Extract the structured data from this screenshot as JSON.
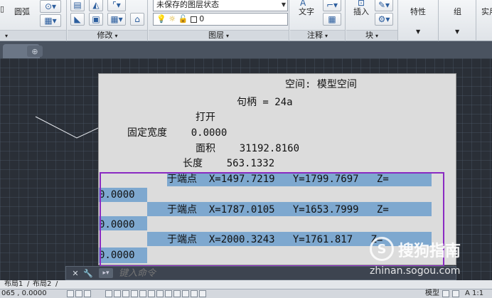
{
  "ribbon": {
    "draw_panel": {
      "arc_label": "圆弧",
      "title": ""
    },
    "modify_panel": {
      "title": "修改"
    },
    "layers_panel": {
      "layer_state": "未保存的图层状态",
      "current_layer": "0",
      "title": "图层"
    },
    "annotation_panel": {
      "text_label": "文字",
      "title": "注释"
    },
    "block_panel": {
      "insert_label": "插入",
      "title": "块"
    },
    "properties_label": "特性",
    "group_label": "组",
    "utilities_label": "实用"
  },
  "tabs": {
    "close_glyph": "×"
  },
  "text_window": {
    "lines": [
      "空间: 模型空间",
      "句柄 = 24a",
      "打开",
      "固定宽度    0.0000",
      "面积    31192.8160",
      "长度    563.1332"
    ],
    "points": [
      {
        "label": "于端点",
        "x": "X=1497.7219",
        "y": "Y=1799.7697",
        "z": "Z=",
        "zval": "0.0000"
      },
      {
        "label": "于端点",
        "x": "X=1787.0105",
        "y": "Y=1653.7999",
        "z": "Z=",
        "zval": "0.0000"
      },
      {
        "label": "于端点",
        "x": "X=2000.3243",
        "y": "Y=1761.817",
        "z": "Z=",
        "zval": "0.0000"
      }
    ]
  },
  "command_line": {
    "placeholder": "键入命令"
  },
  "layout_tabs": [
    "布局1",
    "布局2"
  ],
  "status_bar": {
    "coords": "065 , 0.0000",
    "model_label": "模型",
    "scale": "A 1:1"
  },
  "watermark": {
    "brand": "搜狗指南",
    "url": "zhinan.sogou.com"
  },
  "colors": {
    "highlight": "#7ea8cf",
    "annotation_box": "#8a2ac2",
    "canvas": "#2a2f37"
  }
}
